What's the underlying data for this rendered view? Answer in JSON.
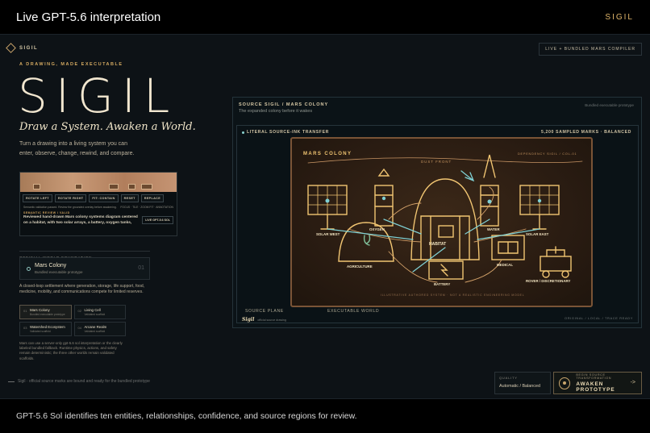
{
  "topbar": {
    "title": "Live GPT-5.6 interpretation",
    "brand": "SIGIL"
  },
  "bottombar": {
    "caption": "GPT-5.6 Sol identifies ten entities, relationships, confidence, and source regions for review."
  },
  "app": {
    "logo": "SIGIL",
    "live_badge": "LIVE + BUNDLED MARS COMPILER",
    "eyebrow": "A DRAWING, MADE EXECUTABLE",
    "title": "SIGIL",
    "tagline": "Draw a System. Awaken a World.",
    "intro": "Turn a drawing into a living system you can enter, observe, change, rewind, and compare.",
    "source_card": {
      "buttons": [
        "ROTATE LEFT",
        "ROTATE RIGHT",
        "FIT: CONTAIN",
        "RESET",
        "REPLACE"
      ],
      "hint_left": "Semantic validation passed. Review the grounded overlay before awakening.",
      "hint_right": "FOCUS · TILE · ZOOM FIT · ANNOTATION",
      "review_label": "SEMANTIC REVIEW / VALID",
      "description": "Reviewed hand-drawn Mars colony systems diagram centered on a habitat, with two solar arrays, a battery, oxygen tanks, water equipment, agriculture greenhouse, medical building, rover",
      "interpret_button": "LIVE GPT-5.6 SOL"
    },
    "foundation_label": "OFFICIAL WORLD FOUNDATION",
    "world": {
      "name": "Mars Colony",
      "sub": "Bundled executable prototype",
      "num": "01"
    },
    "world_description": "A closed-loop settlement where generation, storage, life support, food, medicine, mobility, and communications compete for limited reserves.",
    "worlds": [
      {
        "num": "01",
        "name": "Mars Colony",
        "sub": "Bundled executable prototype"
      },
      {
        "num": "02",
        "name": "Living Cell",
        "sub": "Validated scaffold"
      },
      {
        "num": "03",
        "name": "Watershed Ecosystem",
        "sub": "Validated scaffold"
      },
      {
        "num": "04",
        "name": "Arcane Realm",
        "sub": "Validated scaffold"
      }
    ],
    "note": "Mars can use a server-only gpt-5.6 sol interpretation or the clearly labeled bundled fallback. Runtime physics, actions, and safety remain deterministic; the three other worlds remain validated scaffolds.",
    "footer": "Sigil · official source marks are bound and ready for the bundled prototype",
    "source_panel": {
      "label": "SOURCE SIGIL / MARS COLONY",
      "subtitle": "The expanded colony before it wakes",
      "tag": "Bundled executable prototype",
      "transfer_label": "LITERAL SOURCE-INK TRANSFER",
      "sampled": "5,200 SAMPLED MARKS · BALANCED",
      "source_plane": "SOURCE PLANE",
      "exec_world": "EXECUTABLE WORLD",
      "sig": "Sigil",
      "sig_sub": "official source drawing",
      "right_tag": "ORIGINAL / LOCAL / TRACE READY"
    },
    "drawing": {
      "title": "MARS COLONY",
      "dependency": "DEPENDENCY SIGIL / COL-01",
      "dust": "DUST FRONT",
      "labels": {
        "solar_west": "SOLAR WEST",
        "oxygen": "OXYGEN",
        "water": "WATER",
        "solar_east": "SOLAR EAST",
        "habitat": "HABITAT",
        "agriculture": "AGRICULTURE",
        "battery": "BATTERY",
        "medical": "MEDICAL",
        "rover": "ROVER / DISCRETIONARY"
      },
      "footer": "ILLUSTRATIVE AUTHORED SYSTEM · NOT A REALISTIC ENGINEERING MODEL"
    },
    "quality": {
      "label": "QUALITY",
      "value": "Automatic / Balanced"
    },
    "awaken": {
      "label": "BEGIN SOURCE TRANSFORMATION",
      "button": "AWAKEN PROTOTYPE",
      "arrow": "->"
    }
  }
}
